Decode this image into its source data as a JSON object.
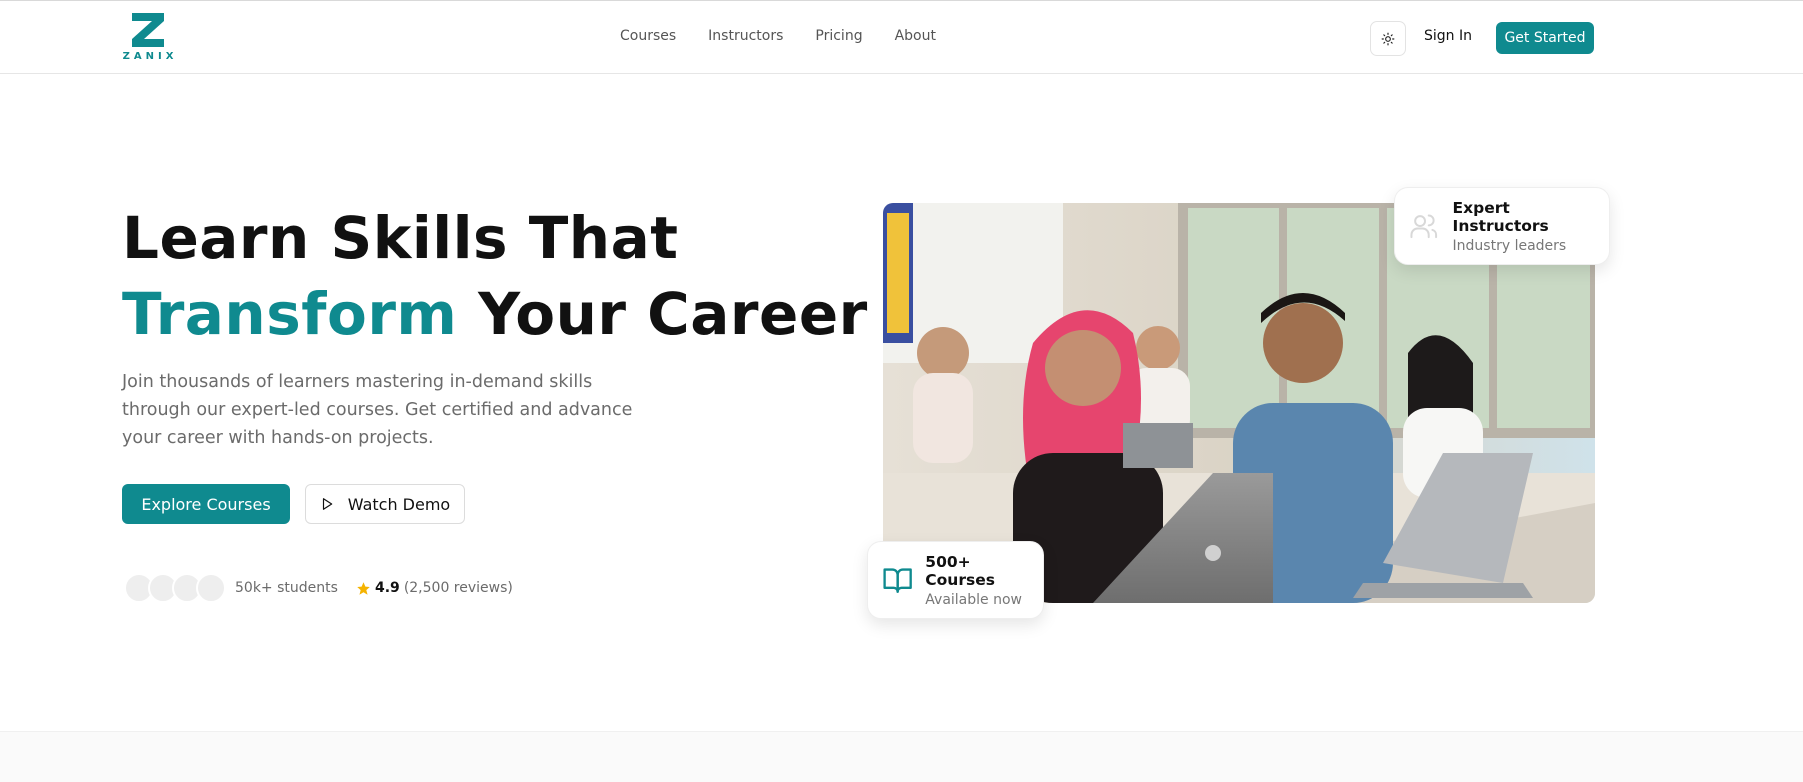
{
  "brand": {
    "logo_letter": "Z",
    "logo_text": "ZANIX",
    "accent_color": "#0f8a8f"
  },
  "nav": {
    "items": [
      "Courses",
      "Instructors",
      "Pricing",
      "About"
    ]
  },
  "header": {
    "theme_icon": "sun-icon",
    "sign_in": "Sign In",
    "get_started": "Get Started"
  },
  "hero": {
    "title_line1": "Learn Skills That",
    "title_accent": "Transform",
    "title_rest": " Your Career",
    "subtitle": "Join thousands of learners mastering in-demand skills through our expert-led courses. Get certified and advance your career with hands-on projects.",
    "explore_button": "Explore Courses",
    "demo_button": "Watch Demo",
    "demo_icon": "play-icon",
    "students_text": "50k+ students",
    "rating_value": "4.9",
    "rating_reviews": "(2,500 reviews)",
    "rating_icon": "star-icon",
    "star_color": "#f5b301"
  },
  "cards": {
    "instructors": {
      "title": "Expert Instructors",
      "subtitle": "Industry leaders",
      "icon": "users-icon"
    },
    "courses": {
      "title": "500+ Courses",
      "subtitle": "Available now",
      "icon": "book-open-icon"
    }
  }
}
